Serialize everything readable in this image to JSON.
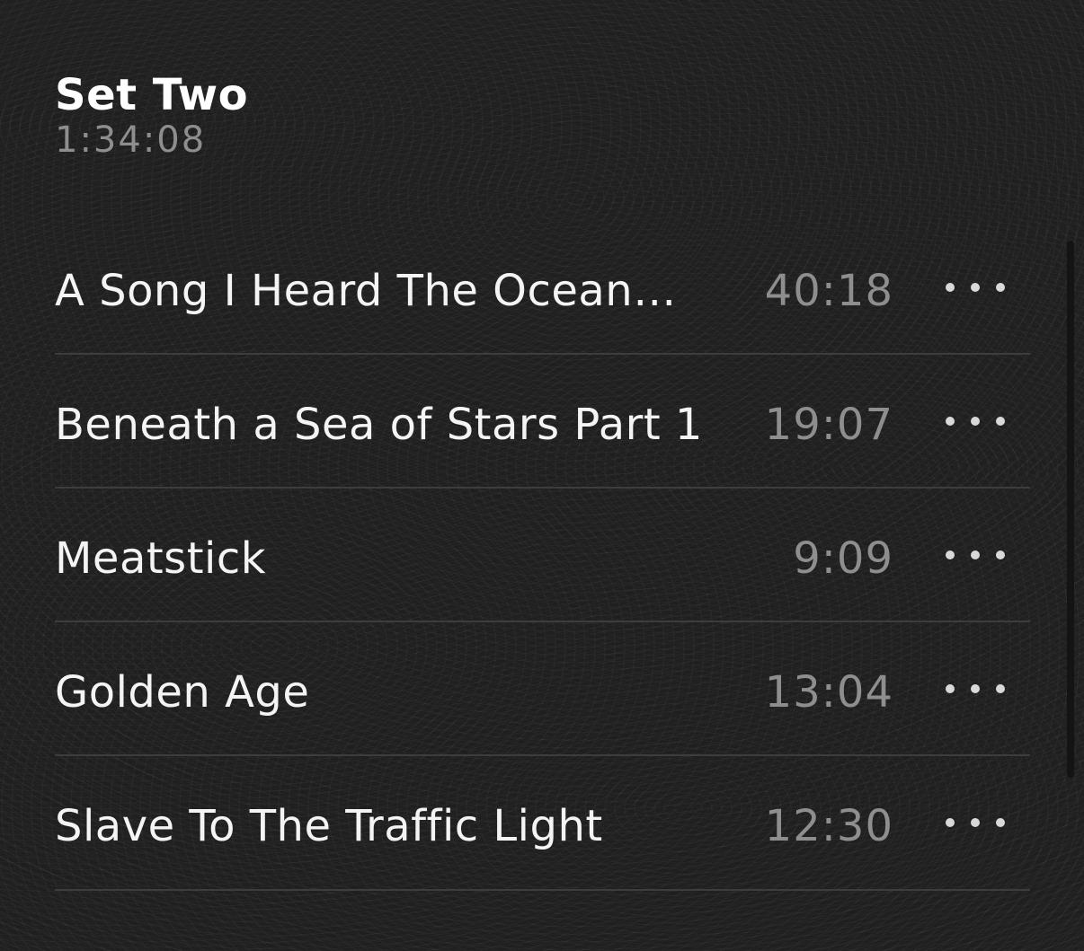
{
  "set": {
    "title": "Set Two",
    "duration": "1:34:08"
  },
  "tracks": [
    {
      "title": "A Song I Heard The Ocean…",
      "duration": "40:18",
      "menu_icon": "more-horizontal-icon"
    },
    {
      "title": "Beneath a Sea of Stars Part 1",
      "duration": "19:07",
      "menu_icon": "more-horizontal-icon"
    },
    {
      "title": "Meatstick",
      "duration": "9:09",
      "menu_icon": "more-horizontal-icon"
    },
    {
      "title": "Golden Age",
      "duration": "13:04",
      "menu_icon": "more-horizontal-icon"
    },
    {
      "title": "Slave To The Traffic Light",
      "duration": "12:30",
      "menu_icon": "more-horizontal-icon"
    }
  ],
  "colors": {
    "background": "#1f1f1f",
    "text_primary": "#f4f4f4",
    "text_secondary": "#8e8e8e",
    "divider": "#3d3d3d"
  }
}
